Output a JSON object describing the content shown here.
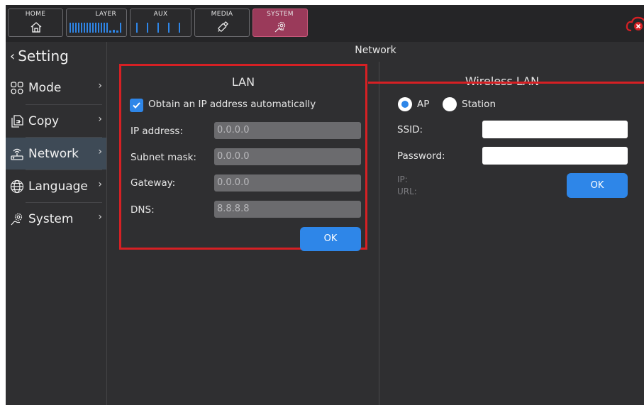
{
  "topbar": {
    "tabs": [
      {
        "label": "HOME",
        "icon": "home-icon"
      },
      {
        "label": "LAYER",
        "icon": "layer-bars-icon"
      },
      {
        "label": "AUX",
        "icon": "aux-bars-icon"
      },
      {
        "label": "MEDIA",
        "icon": "media-usb-icon"
      },
      {
        "label": "SYSTEM",
        "icon": "system-gear-icon"
      }
    ],
    "active_tab": "SYSTEM",
    "cloud_status_icon": "cloud-disconnected-icon"
  },
  "sidebar": {
    "back_label": "Setting",
    "items": [
      {
        "label": "Mode",
        "icon": "mode-grid-icon"
      },
      {
        "label": "Copy",
        "icon": "copy-icon"
      },
      {
        "label": "Network",
        "icon": "router-icon",
        "active": true
      },
      {
        "label": "Language",
        "icon": "globe-icon"
      },
      {
        "label": "System",
        "icon": "gear-hand-icon"
      }
    ]
  },
  "page": {
    "title": "Network"
  },
  "lan": {
    "title": "LAN",
    "dhcp_label": "Obtain an IP address automatically",
    "dhcp_checked": true,
    "fields": [
      {
        "label": "IP address:",
        "value": "0.0.0.0"
      },
      {
        "label": "Subnet mask:",
        "value": "0.0.0.0"
      },
      {
        "label": "Gateway:",
        "value": "0.0.0.0"
      },
      {
        "label": "DNS:",
        "value": "8.8.8.8"
      }
    ],
    "ok_label": "OK"
  },
  "wlan": {
    "title": "Wireless LAN",
    "mode_ap": "AP",
    "mode_station": "Station",
    "selected_mode": "AP",
    "ssid_label": "SSID:",
    "ssid_value": "",
    "password_label": "Password:",
    "password_value": "",
    "ip_label": "IP:",
    "url_label": "URL:",
    "ok_label": "OK"
  },
  "colors": {
    "accent": "#2e86e8",
    "highlight": "#d62024",
    "active_tab": "#9a3a5a"
  }
}
